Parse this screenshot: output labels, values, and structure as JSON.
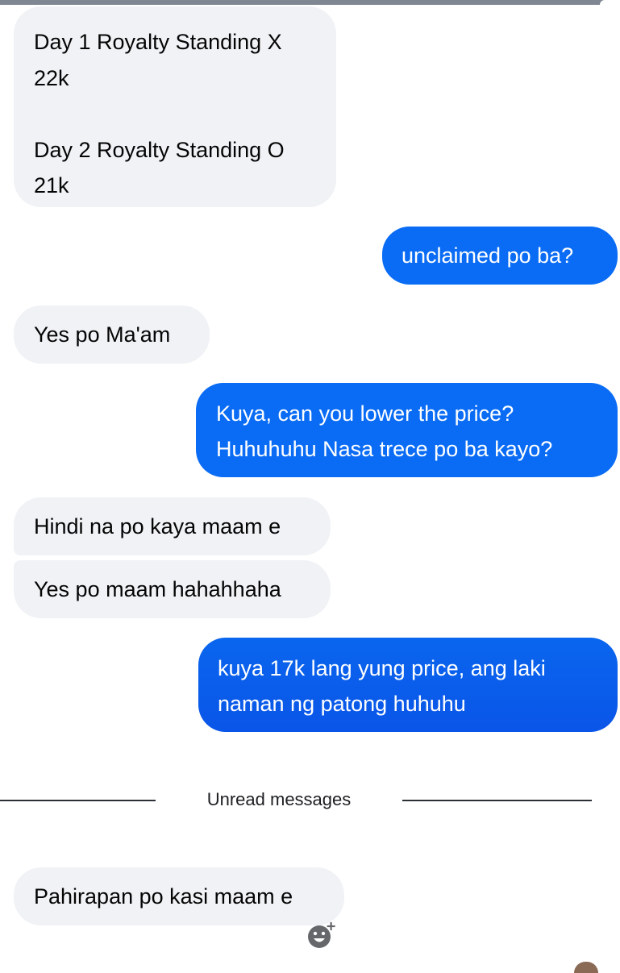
{
  "conversation": {
    "messages": [
      {
        "direction": "incoming",
        "text": "Day 1 Royalty Standing X\n22k\n\nDay 2 Royalty Standing O\n21k"
      },
      {
        "direction": "outgoing",
        "text": "unclaimed po ba?"
      },
      {
        "direction": "incoming",
        "text": "Yes po Ma'am"
      },
      {
        "direction": "outgoing",
        "text": "Kuya, can you lower the price?\nHuhuhuhu Nasa trece po ba kayo?"
      },
      {
        "direction": "incoming",
        "text": "Hindi na po kaya maam e"
      },
      {
        "direction": "incoming",
        "text": "Yes po maam hahahhaha"
      },
      {
        "direction": "outgoing",
        "text": "kuya 17k lang yung price, ang laki\nnaman ng patong huhuhu"
      }
    ],
    "unread_divider": "Unread messages",
    "unread_messages": [
      {
        "direction": "incoming",
        "text": "Pahirapan po kasi maam e"
      }
    ]
  },
  "icons": {
    "reaction": "add-reaction-icon",
    "avatar": "avatar"
  },
  "colors": {
    "incoming_bubble": "#f0f2f5",
    "outgoing_bubble": "#0a6cf5",
    "outgoing_text": "#ffffff",
    "incoming_text": "#050505"
  }
}
